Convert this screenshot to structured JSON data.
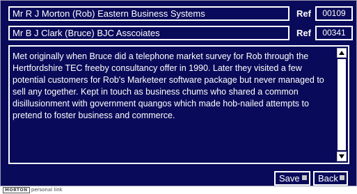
{
  "contacts": [
    {
      "name": "Mr R J Morton (Rob)  Eastern Business Systems",
      "ref_label": "Ref",
      "ref_value": "00109"
    },
    {
      "name": "Mr B J Clark (Bruce)  BJC Asscoiates",
      "ref_label": "Ref",
      "ref_value": "00341"
    }
  ],
  "notes": {
    "text": "Met originally when Bruce did a telephone market survey for Rob through the Hertfordshire TEC freeby consultancy offer in 1990. Later they visited a few potential customers for Rob's Marketeer software package but never managed to sell any together. Kept in touch as business chums who shared a common disillusionment with government quangos which made hob-nailed attempts to pretend to foster business and commerce."
  },
  "buttons": {
    "save": "Save",
    "back": "Back"
  },
  "footer": {
    "brand_mark": "MORTON",
    "brand_text": "personal link"
  },
  "icons": {
    "scroll_up": "arrow-up-icon",
    "scroll_down": "arrow-down-icon"
  },
  "colors": {
    "background": "#0a0a5a",
    "text": "#ffffff",
    "button_indicator": "#c8c8c8"
  }
}
